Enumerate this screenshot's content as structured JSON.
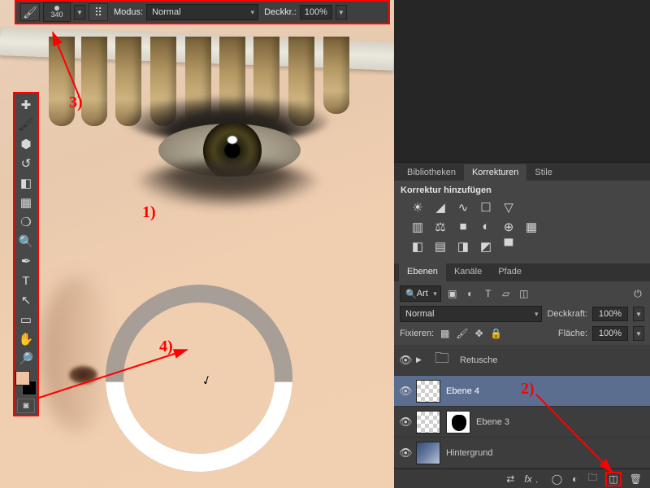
{
  "optionsBar": {
    "brushSize": "340",
    "modeLabel": "Modus:",
    "modeValue": "Normal",
    "opacityLabel": "Deckkr.:",
    "opacityValue": "100%"
  },
  "toolbox": {
    "tools": [
      "healing",
      "brush",
      "stamp",
      "history-brush",
      "eraser",
      "gradient",
      "blur",
      "dodge",
      "pen",
      "type",
      "path-select",
      "rectangle",
      "hand",
      "zoom"
    ]
  },
  "panels": {
    "adjustments": {
      "tabs": {
        "lib": "Bibliotheken",
        "adj": "Korrekturen",
        "styles": "Stile"
      },
      "addLabel": "Korrektur hinzufügen"
    },
    "layers": {
      "tabs": {
        "layers": "Ebenen",
        "channels": "Kanäle",
        "paths": "Pfade"
      },
      "kindLabel": "Art",
      "blendMode": "Normal",
      "opacityLabel": "Deckkraft:",
      "opacityValue": "100%",
      "lockLabel": "Fixieren:",
      "fillLabel": "Fläche:",
      "fillValue": "100%",
      "items": {
        "group": "Retusche",
        "l4": "Ebene 4",
        "l3": "Ebene 3",
        "bg": "Hintergrund"
      }
    }
  },
  "annotations": {
    "a1": "1)",
    "a2": "2)",
    "a3": "3)",
    "a4": "4)"
  }
}
